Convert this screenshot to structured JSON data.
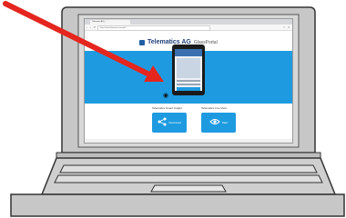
{
  "browser": {
    "tab_title": "Telematics AG | ...",
    "url": "https://www.telematics.example/",
    "nav_glyphs": "‹ › ⟳",
    "toolbar_glyphs": "☆ ≡"
  },
  "page": {
    "brand": "Telematics AG",
    "brand_suffix": "GlassPortal",
    "tagline": "........"
  },
  "features": [
    {
      "label": "Telematics Smart Insight",
      "button_label": "Download",
      "icon": "share-icon"
    },
    {
      "label": "Telematics Live View",
      "button_label": "Start",
      "icon": "eye-icon"
    }
  ],
  "colors": {
    "accent": "#1e9be0",
    "brand": "#1f3f78",
    "arrow": "#e4261e"
  }
}
